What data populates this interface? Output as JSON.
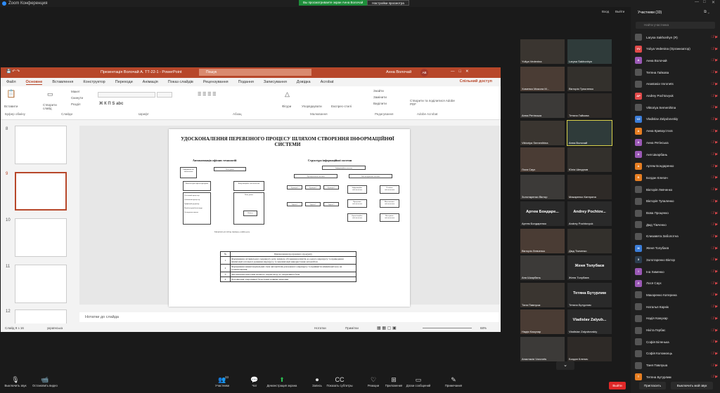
{
  "window": {
    "title": "Zoom Конференция"
  },
  "banner": {
    "viewing": "Вы просматриваете экран Анна Волочай",
    "options": "Настройки просмотра"
  },
  "top": {
    "view": "Вход",
    "exit": "Выйти"
  },
  "ppt": {
    "title": "Презентація Волочай А. ТТ-22-1 - PowerPoint",
    "search": "Пошук",
    "user": "Анна Волочай",
    "avatar": "АВ",
    "tabs": [
      "Файл",
      "Основне",
      "Вставлення",
      "Конструктор",
      "Переходи",
      "Анімація",
      "Показ слайдів",
      "Рецензування",
      "Подання",
      "Записування",
      "Довідка",
      "Acrobat"
    ],
    "share": "Спільний доступ",
    "ribbon": {
      "paste": "Вставити",
      "new_slide": "Створити слайд",
      "layout": "Макет",
      "reset": "Скинути",
      "section": "Розділ",
      "shapes": "Фігури",
      "arrange": "Упорядкувати",
      "quick_styles": "Експрес-стилі",
      "find": "Знайти",
      "replace": "Замінити",
      "select": "Виділити",
      "adobe": "Створити та поділитися Adobe PDF",
      "groups": [
        "Буфер обміну",
        "Слайди",
        "Шрифт",
        "Абзац",
        "Малювання",
        "Редагування",
        "Adobe Acrobat"
      ]
    },
    "thumb_nums": [
      "8",
      "9",
      "10",
      "11",
      "12"
    ],
    "slide": {
      "title": "УДОСКОНАЛЕННЯ ПЕРЕВІЗНОГО ПРОЦЕСУ ШЛЯХОМ СТВОРЕННЯ ІНФОРМАЦІЙНОЇ СИСТЕМИ",
      "num": "9",
      "left_sub": "Автоматизація офісних технологій",
      "right_sub": "Структура інформаційної системи",
      "left_boxes": [
        "Інформація по замовленню",
        "База даних",
        "Комп'ютерна офісна програма",
        "Текстовий процесор",
        "Табличний процесор",
        "Графічний редактор",
        "Комп'ютерний календар",
        "Електронна пошта",
        "Комунікаційне забезпечення",
        "Бази даних",
        "Клієнт",
        "Інформація для вибору маршруту, графіку руху"
      ],
      "right_boxes": [
        "Інформаційна система",
        "Функціональна частина",
        "Забезпечувальна частина",
        "Функція 1",
        "Функція 2",
        "Функція 3",
        "Задача 1",
        "Задача 2",
        "Задача 3",
        "Інформаційне забезпечення",
        "Технічне забезпечення",
        "Програмне забезпечення",
        "Математичне забезпечення",
        "Організаційне забезпечення",
        "Методичне забезпечення"
      ],
      "table_header": [
        "№",
        "Призначення програмного продукту"
      ],
      "table_rows": [
        [
          "1",
          "Формування оптимального маршруту руху шляхом об'єднання клієнтів до одного маршруту та приведення мінімізації загальної довжини маршруту та максимізації використання автомобіля"
        ],
        [
          "2",
          "Формування навантажувальних схем автомобілів для кожного маршруту та прийняття мінімізації часу на розвантаження"
        ],
        [
          "3",
          "Автоматичне внесення значного штрих-коду до оперативної бази"
        ],
        [
          "4",
          "Доповнення оперативної бази даних новими записами"
        ]
      ]
    },
    "notes": "Нотатки до слайда",
    "status": {
      "slide": "Слайд 9 з 16",
      "lang": "українська",
      "notes": "Нотатки",
      "comments": "Примітки",
      "zoom": "68%"
    }
  },
  "gallery": [
    {
      "name": "Yuliya Vedenina"
    },
    {
      "name": "Larysa Sakhonhyn"
    },
    {
      "name": "Хоменко Микола М..."
    },
    {
      "name": "Вікторія Тупаленко"
    },
    {
      "name": "Анна Ретінська"
    },
    {
      "name": "Тетяна Гайкова"
    },
    {
      "name": "Viktoriya Semenihina"
    },
    {
      "name": "Анна Волочай"
    },
    {
      "name": "Лося Саух"
    },
    {
      "name": "Юлія Шеєдпов"
    },
    {
      "name": "Золотаренко Віктор"
    },
    {
      "name": "Макаренко Катерина"
    },
    {
      "name": "Артем Бондаренко",
      "big": "Артем Бондаре..."
    },
    {
      "name": "Andrey Pochtovyuk",
      "big": "Andrey Pochtov..."
    },
    {
      "name": "Вікторія Левченко"
    },
    {
      "name": "Дмд Тімченко"
    },
    {
      "name": "Аня Шкарбань"
    },
    {
      "name": "Женя Толубаєв",
      "big": "Женя Толубаєв"
    },
    {
      "name": "Таня Павлушк"
    },
    {
      "name": "Тетяна Бутурлим",
      "big": "Тетяна Бутурлим"
    },
    {
      "name": "Надія Кожухар"
    },
    {
      "name": "Vladislav Zalyubovskiy",
      "big": "Vladislav Zalyub..."
    },
    {
      "name": "Анастасія Voronets"
    },
    {
      "name": "Богдан Клепач"
    }
  ],
  "panel": {
    "title": "Участники (33)",
    "search": "Найти участника",
    "participants": [
      {
        "av": "",
        "name": "Larysa Sakhonhyn (Я)",
        "color": "#555"
      },
      {
        "av": "YV",
        "name": "Yuliya Vedenina (Организатор)",
        "color": "#e14a4a"
      },
      {
        "av": "А",
        "name": "Анна Волочай",
        "color": "#9b59b6"
      },
      {
        "av": "",
        "name": "Тетяна Гайкова",
        "color": "#555"
      },
      {
        "av": "",
        "name": "Anastasia Voronets",
        "color": "#555"
      },
      {
        "av": "AP",
        "name": "Andrey Pochtovyuk",
        "color": "#e14a4a"
      },
      {
        "av": "",
        "name": "Viktoriya Semenihina",
        "color": "#555"
      },
      {
        "av": "VZ",
        "name": "Vladislav Zalyubovskiy",
        "color": "#3b7dd8"
      },
      {
        "av": "А",
        "name": "Анна Кривоустєєв",
        "color": "#e67e22"
      },
      {
        "av": "А",
        "name": "Анна Ретінська",
        "color": "#9b59b6"
      },
      {
        "av": "А",
        "name": "Аня Шкарбань",
        "color": "#9b59b6"
      },
      {
        "av": "А",
        "name": "Артем Бондаренко",
        "color": "#e67e22"
      },
      {
        "av": "Б",
        "name": "Богдан Клепач",
        "color": "#e67e22"
      },
      {
        "av": "",
        "name": "Вікторія Левченко",
        "color": "#555"
      },
      {
        "av": "",
        "name": "Вікторія Тупаленко",
        "color": "#555"
      },
      {
        "av": "",
        "name": "Вова Проценко",
        "color": "#555"
      },
      {
        "av": "",
        "name": "Дмд Тімченко",
        "color": "#555"
      },
      {
        "av": "",
        "name": "Єлизавета Заболотна",
        "color": "#555"
      },
      {
        "av": "Ж",
        "name": "Женя Толубаєв",
        "color": "#3b7dd8"
      },
      {
        "av": "З",
        "name": "Золотаренко Віктор",
        "color": "#2c3e50"
      },
      {
        "av": "І",
        "name": "Іна Хименко",
        "color": "#9b59b6"
      },
      {
        "av": "Л",
        "name": "Лося Саух",
        "color": "#9b59b6"
      },
      {
        "av": "",
        "name": "Макаренко Катерина",
        "color": "#555"
      },
      {
        "av": "",
        "name": "Наталья Карнік",
        "color": "#555"
      },
      {
        "av": "",
        "name": "Надія Кожухар",
        "color": "#555"
      },
      {
        "av": "",
        "name": "Нікіта Гербас",
        "color": "#555"
      },
      {
        "av": "",
        "name": "Софія Біленька",
        "color": "#555"
      },
      {
        "av": "",
        "name": "Софія Коломоєць",
        "color": "#555"
      },
      {
        "av": "",
        "name": "Таня Павлуша",
        "color": "#555"
      },
      {
        "av": "Т",
        "name": "Тетяна Бутурлим",
        "color": "#e67e22"
      }
    ],
    "invite": "Пригласить",
    "muteall": "Выключить мой звук"
  },
  "toolbar": [
    {
      "icon": "🎙",
      "label": "Выключить звук"
    },
    {
      "icon": "📹",
      "label": "Остановить видео"
    },
    {
      "icon": "👥",
      "label": "Участники"
    },
    {
      "icon": "💬",
      "label": "Чат"
    },
    {
      "icon": "⬆",
      "label": "Демонстрация экрана"
    },
    {
      "icon": "⏺",
      "label": "Запись"
    },
    {
      "icon": "CC",
      "label": "Показать субтитры"
    },
    {
      "icon": "♡",
      "label": "Реакции"
    },
    {
      "icon": "⊞",
      "label": "Приложения"
    },
    {
      "icon": "▭",
      "label": "Доски сообщений"
    },
    {
      "icon": "✎",
      "label": "Примечания"
    }
  ],
  "gallery_count": "33",
  "leave": "Выйти"
}
